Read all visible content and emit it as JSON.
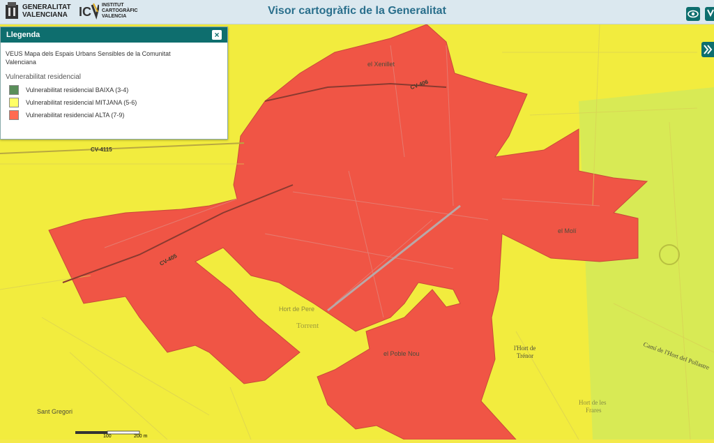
{
  "header": {
    "org_line1": "GENERALITAT",
    "org_line2": "VALENCIANA",
    "inst_line1": "INSTITUT",
    "inst_line2": "CARTOGRÀFIC",
    "inst_line3": "VALENCIA",
    "title": "Visor cartogràfic de la Generalitat",
    "icons": [
      "visibility-icon",
      "user-icon",
      "expand-panel-icon"
    ]
  },
  "legend": {
    "title": "Llegenda",
    "close_symbol": "×",
    "map_title": "VEUS Mapa dels Espais Urbans Sensibles de la Comunitat Valenciana",
    "section": "Vulnerabilitat residencial",
    "items": [
      {
        "label": "Vulnerabilitat residencial BAIXA (3-4)",
        "color": "#5a8f5a"
      },
      {
        "label": "Vulnerabilitat residencial MITJANA (5-6)",
        "color": "#ffff66"
      },
      {
        "label": "Vulnerabilitat residencial ALTA (7-9)",
        "color": "#ff6b52"
      }
    ]
  },
  "map": {
    "colors": {
      "medium": "#f2ec3e",
      "high": "#f05545",
      "low_area": "#d8ea55",
      "bg": "#f4e94a"
    },
    "labels": {
      "xenillet": "el Xenillet",
      "cv406": "CV-406",
      "cv4115": "CV-4115",
      "cv405": "CV-405",
      "moli": "el Molí",
      "torrent": "Torrent",
      "poble_nou": "el Poble Nou",
      "hort1": "l'Hort de",
      "hort2": "Trénor",
      "cami": "Camí de l'Hort del Pollastre",
      "sant_gregori": "Sant Gregori",
      "hort_pere": "Hort de Pere",
      "hort_frares1": "Hort de les",
      "hort_frares2": "Frares"
    },
    "scale": {
      "mid": "100",
      "end": "200 m"
    }
  }
}
